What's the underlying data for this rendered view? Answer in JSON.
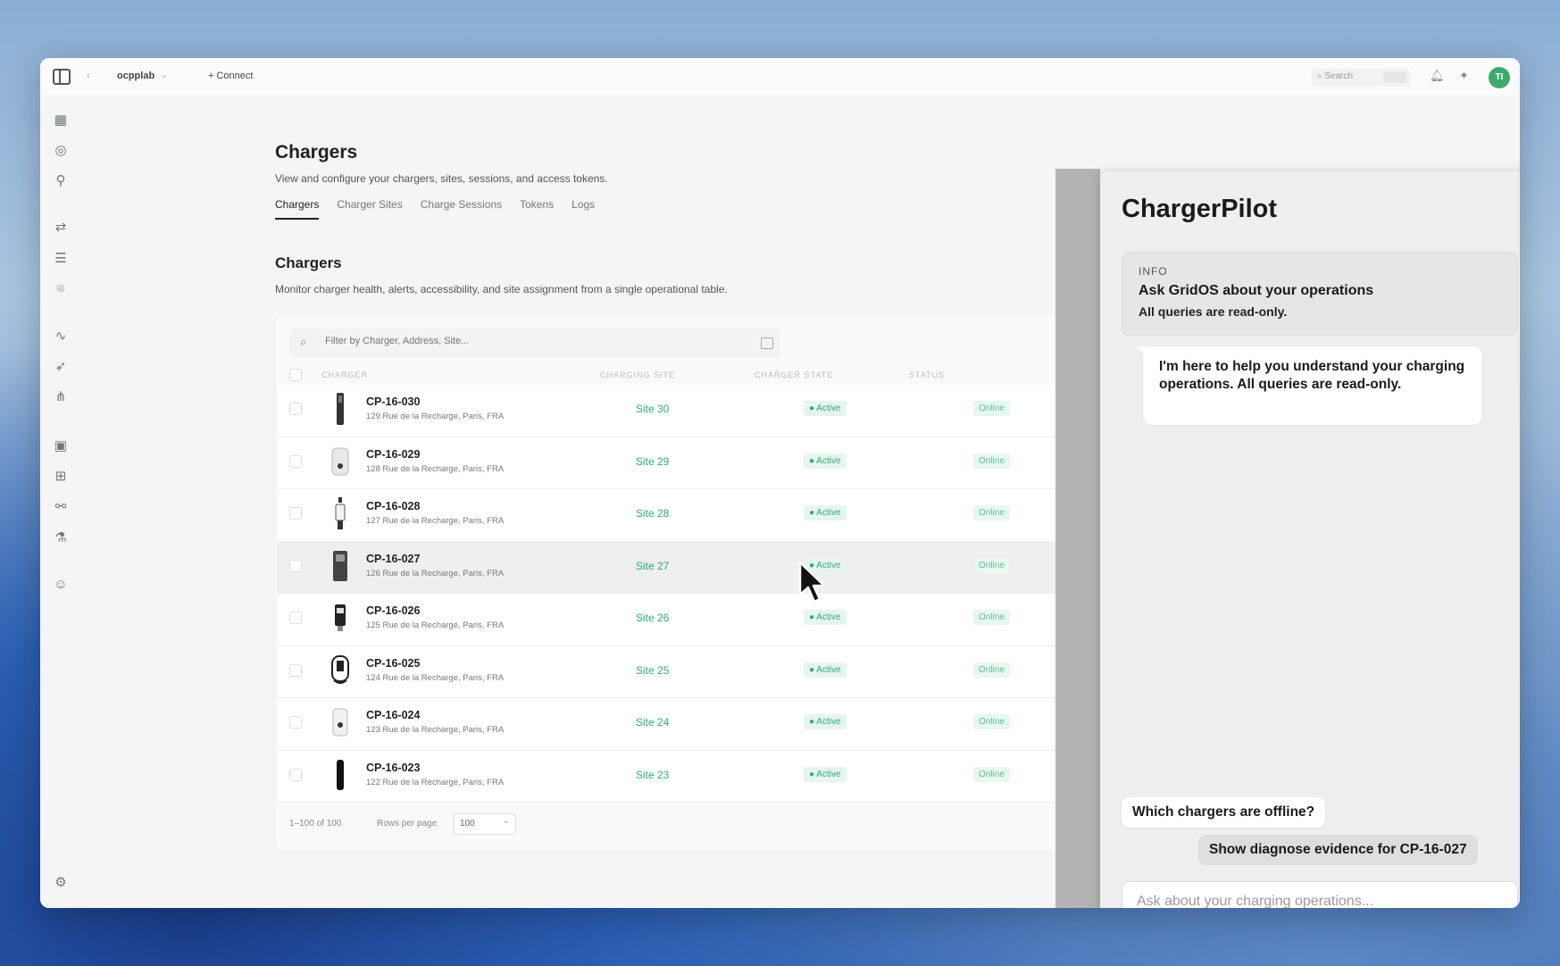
{
  "titlebar": {
    "workspace": "ocpplab",
    "connect_label": "+ Connect",
    "search_placeholder": "Search",
    "avatar_initials": "TI"
  },
  "page": {
    "title": "Chargers",
    "subtitle": "View and configure your chargers, sites, sessions, and access tokens.",
    "tabs": [
      {
        "label": "Chargers",
        "active": true
      },
      {
        "label": "Charger Sites",
        "active": false
      },
      {
        "label": "Charge Sessions",
        "active": false
      },
      {
        "label": "Tokens",
        "active": false
      },
      {
        "label": "Logs",
        "active": false
      }
    ],
    "section_title": "Chargers",
    "section_subtitle": "Monitor charger health, alerts, accessibility, and site assignment from a single operational table."
  },
  "table": {
    "filter_placeholder": "Filter by Charger, Address, Site...",
    "columns": [
      "CHARGER",
      "CHARGING SITE",
      "CHARGER STATE",
      "STATUS"
    ],
    "rows": [
      {
        "id": "CP-16-030",
        "address": "129 Rue de la Recharge, Paris, FRA",
        "site": "Site 30",
        "state": "Active",
        "status": "Online"
      },
      {
        "id": "CP-16-029",
        "address": "128 Rue de la Recharge, Paris, FRA",
        "site": "Site 29",
        "state": "Active",
        "status": "Online"
      },
      {
        "id": "CP-16-028",
        "address": "127 Rue de la Recharge, Paris, FRA",
        "site": "Site 28",
        "state": "Active",
        "status": "Online"
      },
      {
        "id": "CP-16-027",
        "address": "126 Rue de la Recharge, Paris, FRA",
        "site": "Site 27",
        "state": "Active",
        "status": "Online"
      },
      {
        "id": "CP-16-026",
        "address": "125 Rue de la Recharge, Paris, FRA",
        "site": "Site 26",
        "state": "Active",
        "status": "Online"
      },
      {
        "id": "CP-16-025",
        "address": "124 Rue de la Recharge, Paris, FRA",
        "site": "Site 25",
        "state": "Active",
        "status": "Online"
      },
      {
        "id": "CP-16-024",
        "address": "123 Rue de la Recharge, Paris, FRA",
        "site": "Site 24",
        "state": "Active",
        "status": "Online"
      },
      {
        "id": "CP-16-023",
        "address": "122 Rue de la Recharge, Paris, FRA",
        "site": "Site 23",
        "state": "Active",
        "status": "Online"
      }
    ],
    "footer_count": "1–100  of  100",
    "rows_per_page_label": "Rows per page",
    "rows_per_page_value": "100"
  },
  "assistant": {
    "title": "ChargerPilot",
    "info_label": "INFO",
    "info_heading": "Ask GridOS about your operations",
    "info_sub": "All queries are read-only.",
    "message": "I'm here to help you understand your charging operations. All queries are read-only.",
    "suggestions": [
      "Which chargers are offline?",
      "Show diagnose evidence for CP-16-027"
    ],
    "input_placeholder": "Ask about your charging operations..."
  },
  "colors": {
    "accent_green": "#2eaa78",
    "avatar_green": "#3daa6e"
  }
}
